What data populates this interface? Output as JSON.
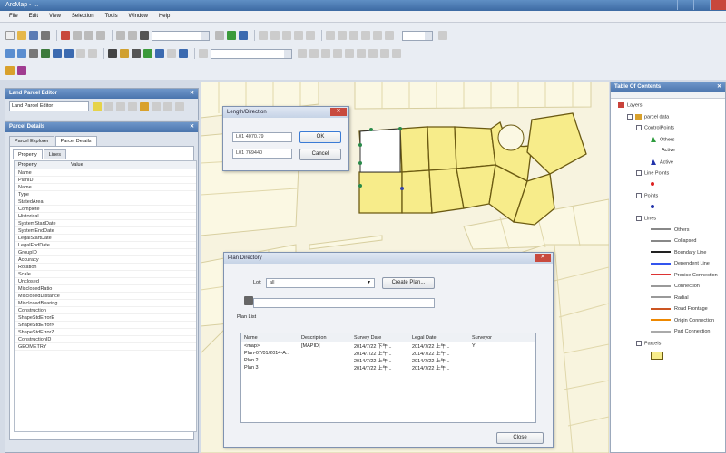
{
  "window": {
    "title": "ArcMap - ..."
  },
  "menu": [
    "File",
    "Edit",
    "View",
    "Selection",
    "Tools",
    "Window",
    "Help"
  ],
  "parcel_editor": {
    "title": "Land Parcel Editor",
    "combo": "Land Parcel Editor"
  },
  "parcel_details": {
    "title": "Parcel Details",
    "tabs": [
      "Parcel Explorer",
      "Parcel Details"
    ],
    "subtabs": [
      "Property",
      "Lines"
    ],
    "columns": [
      "Property",
      "Value"
    ],
    "properties": [
      "Name",
      "PlanID",
      "Name",
      "Type",
      "StatedArea",
      "Complete",
      "Historical",
      "SystemStartDate",
      "SystemEndDate",
      "LegalStartDate",
      "LegalEndDate",
      "GroupID",
      "Accuracy",
      "Rotation",
      "Scale",
      "Unclosed",
      "MisclosedRatio",
      "MisclosedDistance",
      "MisclosedBearing",
      "Construction",
      "ShapeStdErrorE",
      "ShapeStdErrorN",
      "ShapeStdErrorZ",
      "ConstructionID",
      "GEOMETRY"
    ]
  },
  "length_direction": {
    "title": "Length/Direction",
    "field1": "L01 4070.79",
    "field2": "L01 769440",
    "ok": "OK",
    "cancel": "Cancel"
  },
  "plan_directory": {
    "title": "Plan Directory",
    "lot_label": "Lot:",
    "lot_value": "all",
    "create_plan": "Create Plan...",
    "plan_list_label": "Plan List",
    "columns": [
      "Name",
      "Description",
      "Survey Date",
      "Legal Date",
      "Surveyor"
    ],
    "rows": [
      [
        "<map>",
        "[MAPID]",
        "2014/7/22 下午...",
        "2014/7/22 上午...",
        "Y"
      ],
      [
        "Plan-07/01/2014-A...",
        "",
        "2014/7/22 上午...",
        "2014/7/22 上午...",
        ""
      ],
      [
        "Plan 2",
        "",
        "2014/7/22 上午...",
        "2014/7/22 上午...",
        ""
      ],
      [
        "Plan 3",
        "",
        "2014/7/22 上午...",
        "2014/7/22 上午...",
        ""
      ]
    ],
    "close": "Close"
  },
  "toc": {
    "title": "Table Of Contents",
    "items": [
      {
        "label": "Layers",
        "kind": "root"
      },
      {
        "label": "parcel data",
        "kind": "group"
      },
      {
        "label": "ControlPoints",
        "kind": "layer"
      },
      {
        "label": "Others",
        "kind": "legend",
        "color": "#2e9c3e",
        "shape": "triangle"
      },
      {
        "label": "Active",
        "kind": "legend",
        "color": "#2e9c3e",
        "shape": "none"
      },
      {
        "label": "Active",
        "kind": "legend",
        "color": "#2233aa",
        "shape": "triangle"
      },
      {
        "label": "Line Points",
        "kind": "layer"
      },
      {
        "label": "",
        "kind": "legend",
        "color": "#d22",
        "shape": "dot"
      },
      {
        "label": "Points",
        "kind": "layer"
      },
      {
        "label": "",
        "kind": "legend",
        "color": "#2233aa",
        "shape": "dot"
      },
      {
        "label": "Lines",
        "kind": "layer"
      },
      {
        "label": "Others",
        "kind": "legend",
        "color": "#888888",
        "shape": "line"
      },
      {
        "label": "Collapsed",
        "kind": "legend",
        "color": "#888888",
        "shape": "line"
      },
      {
        "label": "Boundary Line",
        "kind": "legend",
        "color": "#222222",
        "shape": "line"
      },
      {
        "label": "Dependent Line",
        "kind": "legend",
        "color": "#3355ee",
        "shape": "line"
      },
      {
        "label": "Precise Connection",
        "kind": "legend",
        "color": "#dd3333",
        "shape": "line"
      },
      {
        "label": "Connection",
        "kind": "legend",
        "color": "#999999",
        "shape": "line"
      },
      {
        "label": "Radial",
        "kind": "legend",
        "color": "#999999",
        "shape": "line"
      },
      {
        "label": "Road Frontage",
        "kind": "legend",
        "color": "#cc5522",
        "shape": "line"
      },
      {
        "label": "Origin Connection",
        "kind": "legend",
        "color": "#ee8800",
        "shape": "line"
      },
      {
        "label": "Part Connection",
        "kind": "legend",
        "color": "#aaaaaa",
        "shape": "line"
      },
      {
        "label": "Parcels",
        "kind": "layer"
      },
      {
        "label": "",
        "kind": "legend",
        "color": "#f7ec8a",
        "shape": "box"
      }
    ]
  }
}
